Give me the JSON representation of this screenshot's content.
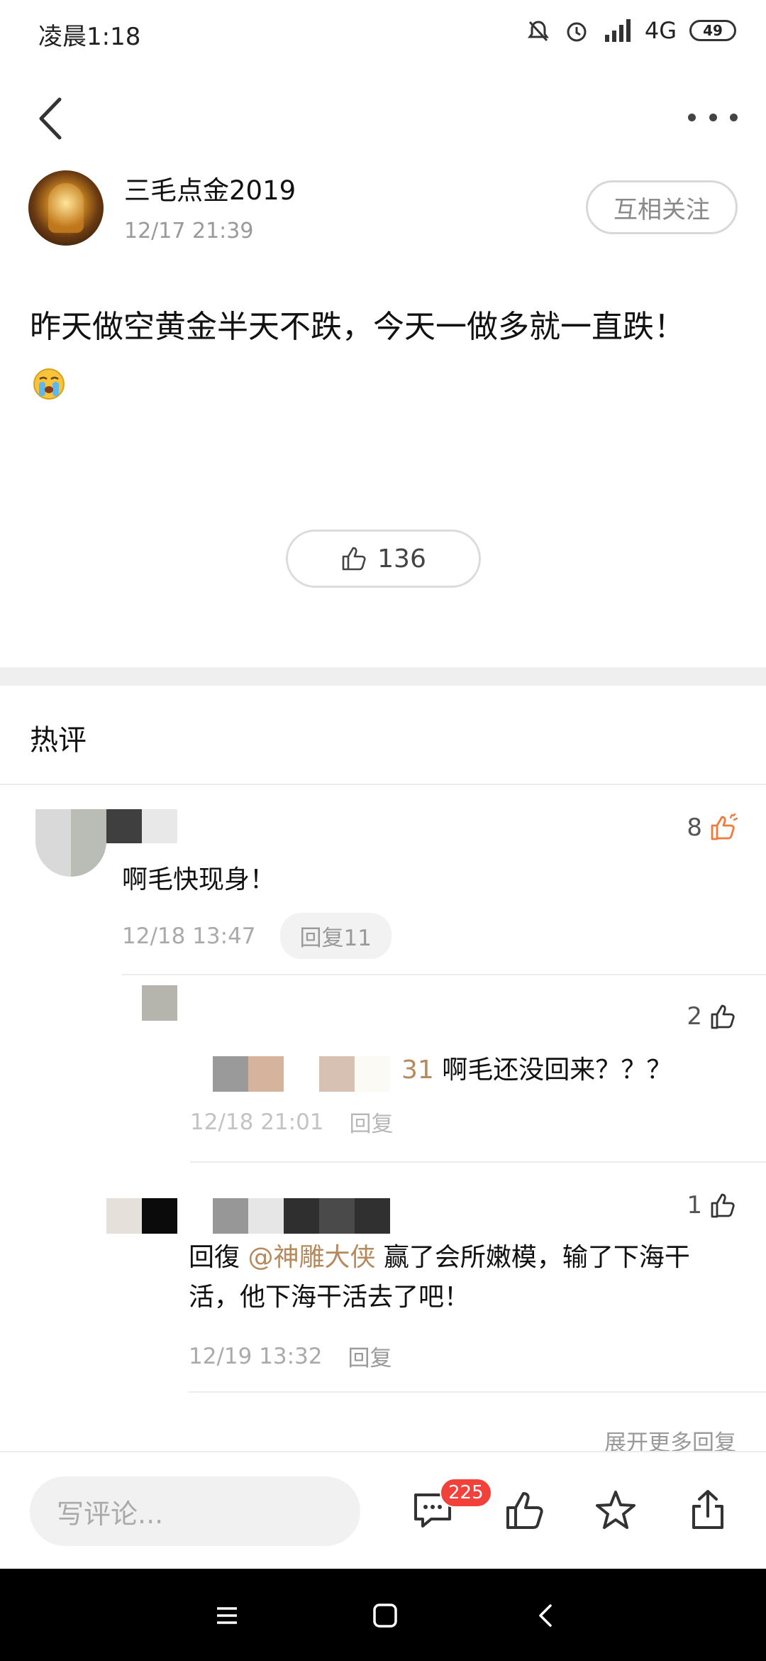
{
  "status_bar": {
    "time": "凌晨1:18",
    "network": "4G",
    "battery": "49"
  },
  "post": {
    "author_name": "三毛点金2019",
    "time": "12/17 21:39",
    "follow_label": "互相关注",
    "text": "昨天做空黄金半天不跌，今天一做多就一直跌！",
    "emoji": "crying-face",
    "like_count": "136"
  },
  "comments_section": {
    "title": "热评",
    "comments": [
      {
        "text": "啊毛快现身！",
        "time": "12/18 13:47",
        "reply_label": "回复11",
        "likes": "8",
        "liked": true
      },
      {
        "text_prefix": "31",
        "text": " 啊毛还没回来？？？",
        "time": "12/18 21:01",
        "reply_label": "回复",
        "likes": "2"
      },
      {
        "reply_word": "回復",
        "mention": "@神雕大侠",
        "text_line1": " 赢了会所嫩模，输了下海干",
        "text_line2": "活，他下海干活去了吧！",
        "time": "12/19 13:32",
        "reply_label": "回复",
        "likes": "1"
      }
    ],
    "more_replies": "展开更多回复"
  },
  "bottom_bar": {
    "input_placeholder": "写评论...",
    "comment_count": "225"
  },
  "colors": {
    "accent": "#f2403b",
    "liked": "#f07a3c",
    "mention": "#b68a5e"
  }
}
